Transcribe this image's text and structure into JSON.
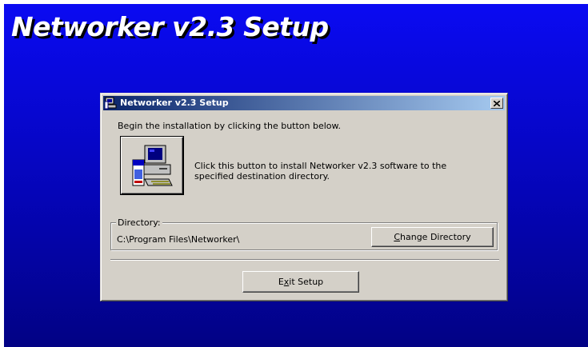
{
  "background": {
    "title": "Networker v2.3 Setup",
    "gradient_top": "#0a0af2",
    "gradient_bottom": "#020284"
  },
  "dialog": {
    "title": "Networker v2.3 Setup",
    "title_icon": "setup-app-icon",
    "close_icon": "close-icon",
    "intro": "Begin the installation by clicking the button below.",
    "install_button_icon": "computer-install-icon",
    "install_description": "Click this button to install Networker v2.3 software to the specified destination directory.",
    "directory": {
      "legend": "Directory:",
      "path": "C:\\Program Files\\Networker\\",
      "change_button": {
        "mnemonic": "C",
        "rest": "hange Directory"
      }
    },
    "exit_button": {
      "before": "E",
      "mnemonic": "x",
      "after": "it Setup"
    },
    "titlebar_colors": [
      "#0a246a",
      "#a6caf0"
    ],
    "face_color": "#d4d0c8"
  }
}
